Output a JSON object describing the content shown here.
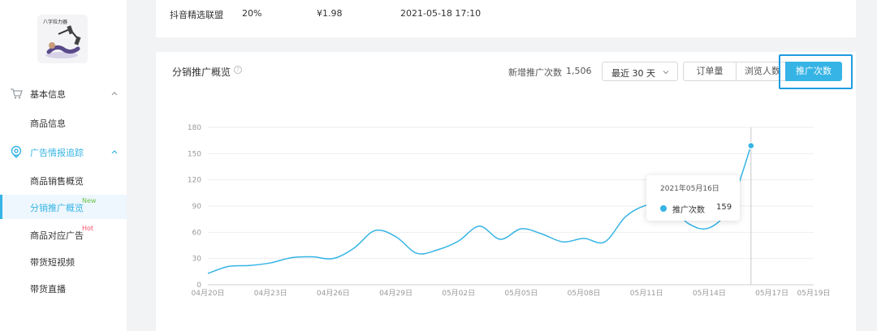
{
  "sidebar": {
    "product_image": {
      "caption": "八字拉力器"
    },
    "groups": [
      {
        "label": "基本信息",
        "icon": "cart-icon",
        "expanded": true,
        "items": [
          {
            "label": "商品信息"
          }
        ]
      },
      {
        "label": "广告情报追踪",
        "icon": "location-pin-icon",
        "expanded": true,
        "active": true,
        "items": [
          {
            "label": "商品销售概览"
          },
          {
            "label": "分销推广概览",
            "tag": "New",
            "active": true
          },
          {
            "label": "商品对应广告",
            "tag": "Hot"
          },
          {
            "label": "带货短视频"
          },
          {
            "label": "带货直播"
          }
        ]
      }
    ]
  },
  "top_card": {
    "values": [
      "抖音精选联盟",
      "20%",
      "¥1.98",
      "2021-05-18 17:10"
    ]
  },
  "overview": {
    "title": "分销推广概览",
    "stat_label": "新增推广次数",
    "stat_value": "1,506",
    "range": "最近 30 天",
    "tabs": [
      "订单量",
      "浏览人数",
      "推广次数"
    ],
    "active_tab": "推广次数"
  },
  "tooltip": {
    "date": "2021年05月16日",
    "series": "推广次数",
    "value": "159"
  },
  "colors": {
    "accent": "#36b4e5",
    "focus": "#1f9be0",
    "new": "#6cc24a",
    "hot": "#ff4d6a"
  },
  "chart_data": {
    "type": "line",
    "x_ticks": [
      "04月20日",
      "04月23日",
      "04月26日",
      "04月29日",
      "05月02日",
      "05月05日",
      "05月08日",
      "05月11日",
      "05月14日",
      "05月17日",
      "05月19日"
    ],
    "y_ticks": [
      0,
      30,
      60,
      90,
      120,
      150,
      180
    ],
    "ylim": [
      0,
      180
    ],
    "grid": true,
    "legend": "none",
    "series": [
      {
        "values": [
          [
            "04-20",
            13
          ],
          [
            "04-21",
            21
          ],
          [
            "04-22",
            22
          ],
          [
            "04-23",
            25
          ],
          [
            "04-24",
            31
          ],
          [
            "04-25",
            32
          ],
          [
            "04-26",
            30
          ],
          [
            "04-27",
            42
          ],
          [
            "04-28",
            62
          ],
          [
            "04-29",
            55
          ],
          [
            "04-30",
            36
          ],
          [
            "05-01",
            40
          ],
          [
            "05-02",
            50
          ],
          [
            "05-03",
            67
          ],
          [
            "05-04",
            52
          ],
          [
            "05-05",
            64
          ],
          [
            "05-06",
            58
          ],
          [
            "05-07",
            49
          ],
          [
            "05-08",
            53
          ],
          [
            "05-09",
            49
          ],
          [
            "05-10",
            78
          ],
          [
            "05-11",
            91
          ],
          [
            "05-12",
            92
          ],
          [
            "05-13",
            70
          ],
          [
            "05-14",
            65
          ],
          [
            "05-15",
            90
          ],
          [
            "05-16",
            159
          ]
        ]
      }
    ],
    "highlight": {
      "x": "05-16",
      "value": 159
    }
  }
}
